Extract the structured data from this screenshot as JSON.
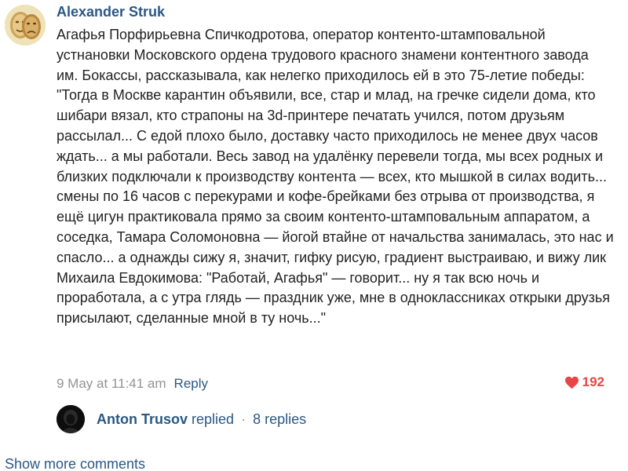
{
  "comment": {
    "author": "Alexander Struk",
    "avatar_icon": "theater-masks-avatar",
    "text": "Агафья Порфирьевна Спичкодротова, оператор контенто-штамповальной устнановки Московского ордена трудового красного знамени контентного завода им. Бокассы, рассказывала, как нелегко приходилось ей в это 75-летие победы: \"Тогда в Москве карантин объявили, все, стар и млад, на гречке сидели дома, кто шибари вязал, кто страпоны на 3d-принтере печатать учился, потом друзьям рассылал... С едой плохо было, доставку часто приходилось не менее двух часов ждать... а мы работали. Весь завод на удалёнку перевели тогда, мы всех родных и близких подключали к производству контента — всех, кто мышкой в силах водить... смены по 16 часов с перекурами и кофе-брейками без отрыва от производства, я ещё цигун практиковала прямо за своим контенто-штамповальным аппаратом, а соседка, Тамара Соломоновна — йогой втайне от начальства занималась, это нас и спасло... а однажды сижу я, значит, гифку рисую, градиент выстраиваю, и вижу лик Михаила Евдокимова: \"Работай, Агафья\" — говорит... ну я так всю ночь и проработала, а с утра глядь — праздник уже, мне в одноклассниках открыки друзья присылают, сделанные мной в ту ночь...\"",
    "date": "9 May at 11:41 am",
    "reply_label": "Reply",
    "likes": "192",
    "like_icon": "heart-icon",
    "like_color": "#e64646"
  },
  "replies": {
    "author": "Anton Trusov",
    "action": "replied",
    "separator": "·",
    "count_label": "8 replies",
    "avatar_icon": "dark-hooded-avatar"
  },
  "show_more_label": "Show more comments",
  "colors": {
    "link": "#2a5885",
    "meta": "#939393",
    "text": "#222222"
  }
}
